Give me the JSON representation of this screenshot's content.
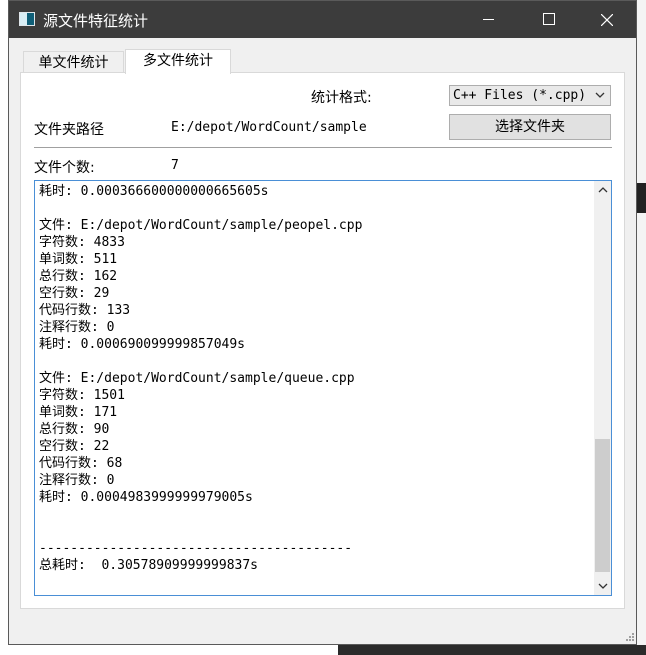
{
  "window": {
    "title": "源文件特征统计",
    "tabs": [
      "单文件统计",
      "多文件统计"
    ],
    "active_tab": 1
  },
  "form": {
    "format_label": "统计格式:",
    "format_value": "C++ Files (*.cpp)",
    "folder_label": "文件夹路径",
    "folder_path": "E:/depot/WordCount/sample",
    "select_folder_button": "选择文件夹",
    "file_count_label": "文件个数:",
    "file_count_value": "7"
  },
  "output": {
    "lines": [
      "耗时: 0.000366600000000665605s",
      "",
      "文件: E:/depot/WordCount/sample/peopel.cpp",
      "字符数: 4833",
      "单词数: 511",
      "总行数: 162",
      "空行数: 29",
      "代码行数: 133",
      "注释行数: 0",
      "耗时: 0.000690099999857049s",
      "",
      "文件: E:/depot/WordCount/sample/queue.cpp",
      "字符数: 1501",
      "单词数: 171",
      "总行数: 90",
      "空行数: 22",
      "代码行数: 68",
      "注释行数: 0",
      "耗时: 0.0004983999999979005s",
      "",
      "",
      "----------------------------------------",
      "总耗时:  0.30578909999999837s"
    ]
  }
}
